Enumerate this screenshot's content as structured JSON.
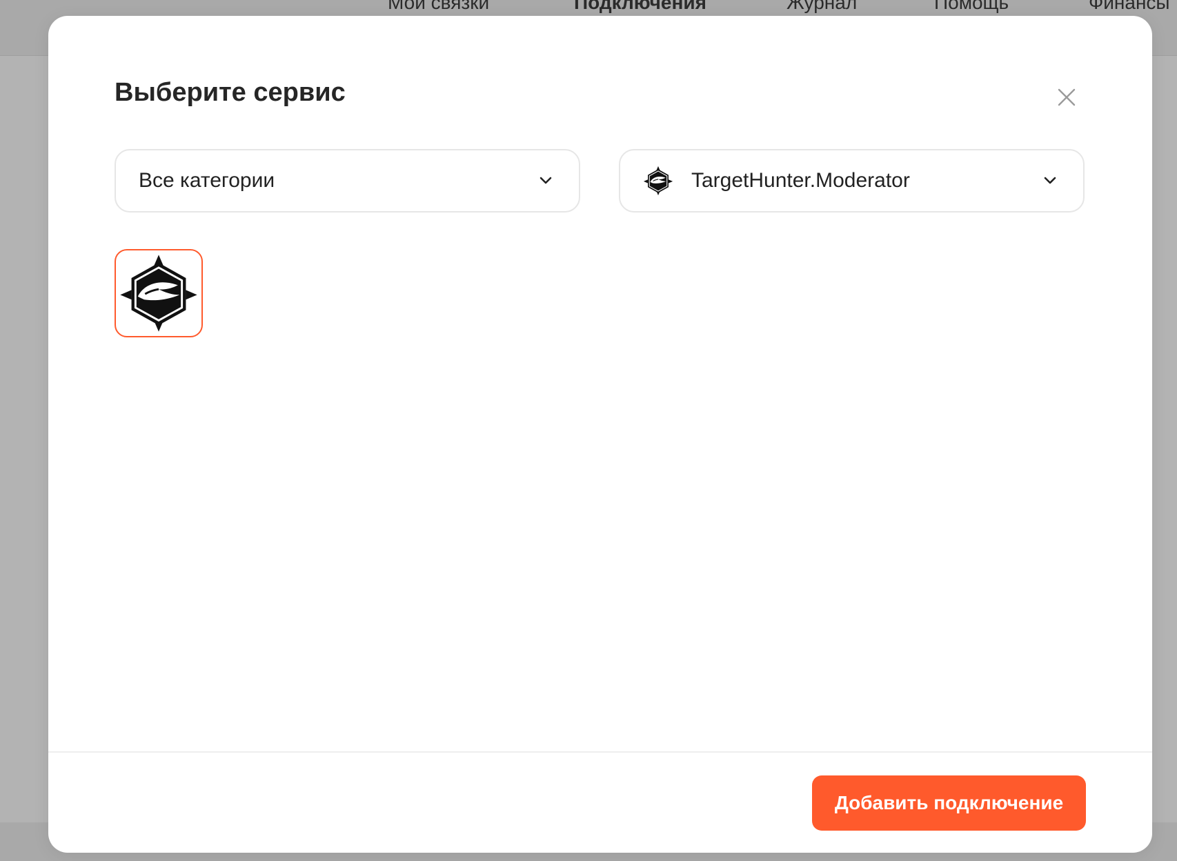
{
  "background": {
    "nav": [
      {
        "label": "Мои связки",
        "active": false
      },
      {
        "label": "Подключения",
        "active": true
      },
      {
        "label": "Журнал",
        "active": false
      },
      {
        "label": "Помощь",
        "active": false
      },
      {
        "label": "Финансы",
        "active": false
      }
    ]
  },
  "modal": {
    "title": "Выберите сервис",
    "close_icon": "close-icon",
    "category_select": {
      "value": "Все категории",
      "icon": "chevron-down-icon"
    },
    "service_select": {
      "value": "TargetHunter.Moderator",
      "logo": "targethunter-logo-icon",
      "icon": "chevron-down-icon"
    },
    "services": [
      {
        "logo": "targethunter-logo-icon",
        "selected": true
      }
    ],
    "submit_label": "Добавить подключение"
  },
  "colors": {
    "accent": "#ff5a2c",
    "overlay": "#b3b3b3",
    "text": "#262626",
    "border": "#e6e6e6"
  }
}
